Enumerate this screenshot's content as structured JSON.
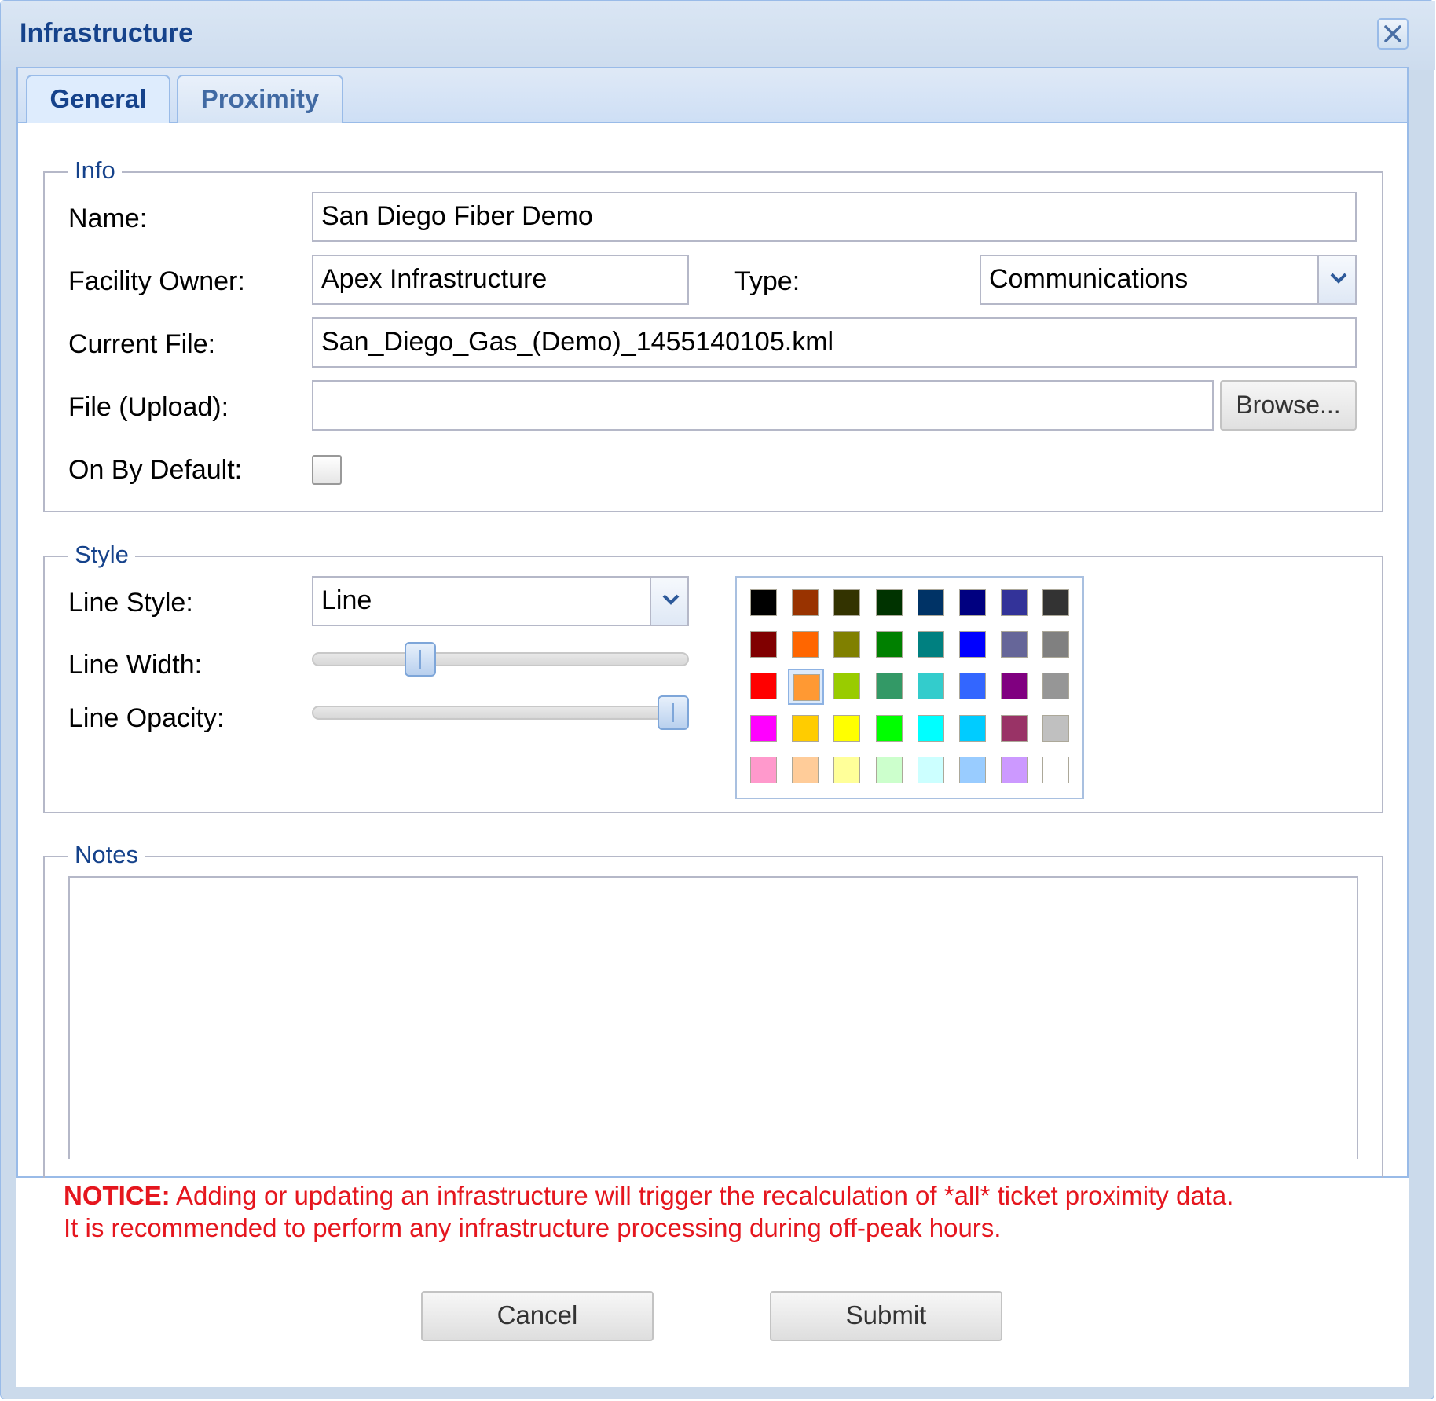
{
  "window": {
    "title": "Infrastructure"
  },
  "tabs": [
    {
      "label": "General",
      "active": true
    },
    {
      "label": "Proximity",
      "active": false
    }
  ],
  "info": {
    "legend": "Info",
    "name_label": "Name:",
    "name_value": "San Diego Fiber Demo",
    "owner_label": "Facility Owner:",
    "owner_value": "Apex Infrastructure",
    "type_label": "Type:",
    "type_value": "Communications",
    "current_file_label": "Current File:",
    "current_file_value": "San_Diego_Gas_(Demo)_1455140105.kml",
    "upload_label": "File (Upload):",
    "upload_value": "",
    "browse_label": "Browse...",
    "default_label": "On By Default:",
    "default_checked": false
  },
  "style": {
    "legend": "Style",
    "line_style_label": "Line Style:",
    "line_style_value": "Line",
    "line_width_label": "Line Width:",
    "line_width_fraction": 0.25,
    "line_opacity_label": "Line Opacity:",
    "line_opacity_fraction": 1.0,
    "selected_color": "#ff9933",
    "palette": [
      [
        "#000000",
        "#993300",
        "#333300",
        "#003300",
        "#003366",
        "#000080",
        "#333399",
        "#333333"
      ],
      [
        "#800000",
        "#ff6600",
        "#808000",
        "#008000",
        "#008080",
        "#0000ff",
        "#666699",
        "#808080"
      ],
      [
        "#ff0000",
        "#ff9933",
        "#99cc00",
        "#339966",
        "#33cccc",
        "#3366ff",
        "#800080",
        "#969696"
      ],
      [
        "#ff00ff",
        "#ffcc00",
        "#ffff00",
        "#00ff00",
        "#00ffff",
        "#00ccff",
        "#993366",
        "#c0c0c0"
      ],
      [
        "#ff99cc",
        "#ffcc99",
        "#ffff99",
        "#ccffcc",
        "#ccffff",
        "#99ccff",
        "#cc99ff",
        "#ffffff"
      ]
    ]
  },
  "notes": {
    "legend": "Notes",
    "value": ""
  },
  "notice": {
    "bold": "NOTICE:",
    "text1": " Adding or updating an infrastructure will trigger the recalculation of *all* ticket proximity data.",
    "text2": "It is recommended to perform any infrastructure processing during off-peak hours."
  },
  "buttons": {
    "cancel": "Cancel",
    "submit": "Submit"
  }
}
